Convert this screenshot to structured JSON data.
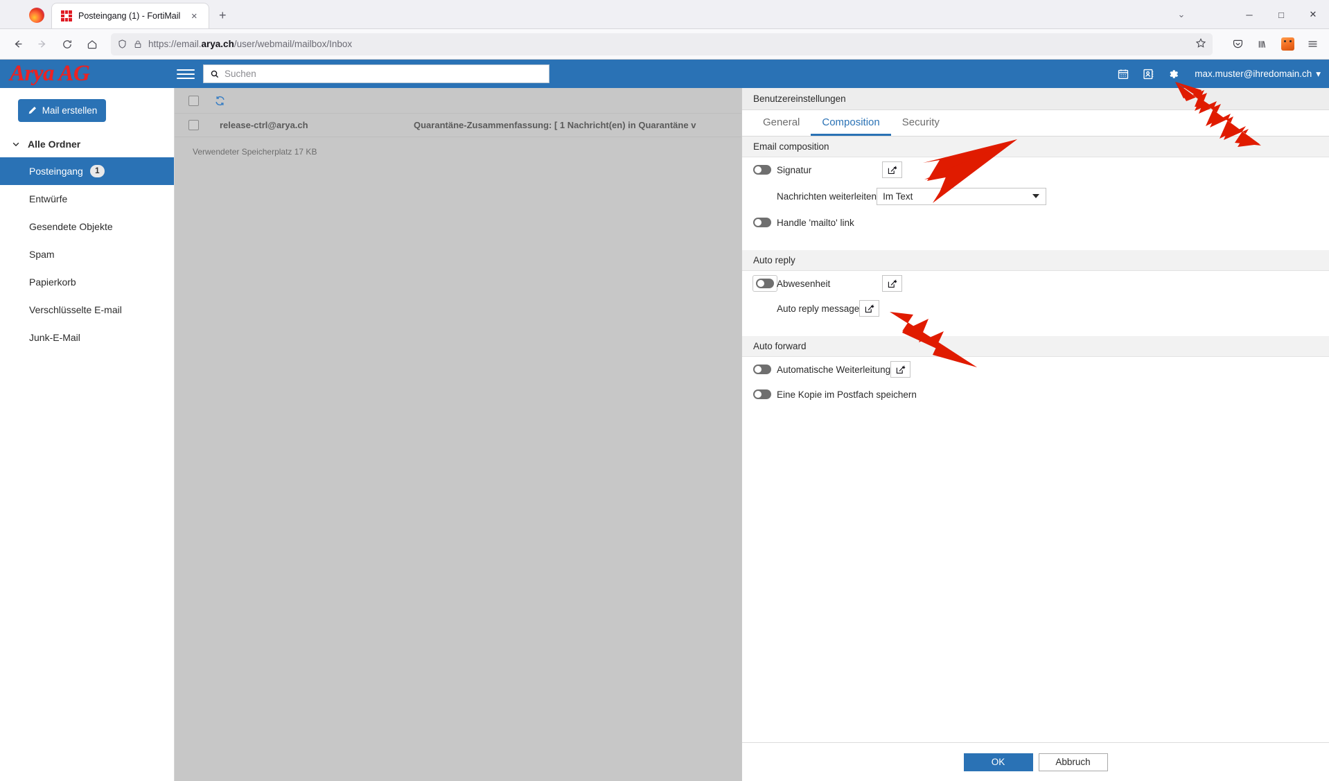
{
  "browser": {
    "tab_title": "Posteingang (1) - FortiMail",
    "tab_close_label": "×",
    "new_tab_label": "+",
    "url_prefix": "https://email.",
    "url_domain": "arya.ch",
    "url_suffix": "/user/webmail/mailbox/Inbox",
    "window_chevron": "⌄",
    "window_minimize": "─",
    "window_maximize": "□",
    "window_close": "✕",
    "icons": {
      "firefox": "firefox-logo-icon",
      "favicon": "fortimail-favicon-icon",
      "back": "back-arrow-icon",
      "forward": "forward-arrow-icon",
      "reload": "reload-icon",
      "home": "home-icon",
      "shield": "shield-icon",
      "lock": "padlock-icon",
      "star": "bookmark-star-icon",
      "pocket": "save-to-pocket-icon",
      "library": "library-icon",
      "extension": "metamask-extension-icon",
      "menu": "hamburger-menu-icon"
    }
  },
  "app_header": {
    "brand": "Arya AG",
    "menu_icon": "hamburger-menu-icon",
    "search_placeholder": "Suchen",
    "search_value": "",
    "calendar_icon": "calendar-icon",
    "contacts_icon": "address-book-icon",
    "settings_icon": "gear-icon",
    "user_email": "max.muster@ihredomain.ch",
    "user_caret": "▾"
  },
  "sidebar": {
    "compose_label": "Mail erstellen",
    "compose_icon": "pencil-icon",
    "all_folders_label": "Alle Ordner",
    "all_folders_caret": "⌄",
    "items": [
      {
        "label": "Posteingang",
        "count": "1",
        "active": true
      },
      {
        "label": "Entwürfe",
        "count": "",
        "active": false
      },
      {
        "label": "Gesendete Objekte",
        "count": "",
        "active": false
      },
      {
        "label": "Spam",
        "count": "",
        "active": false
      },
      {
        "label": "Papierkorb",
        "count": "",
        "active": false
      },
      {
        "label": "Verschlüsselte E-mail",
        "count": "",
        "active": false
      },
      {
        "label": "Junk-E-Mail",
        "count": "",
        "active": false
      }
    ]
  },
  "maillist": {
    "select_all_icon": "checkbox-icon",
    "refresh_icon": "refresh-icon",
    "rows": [
      {
        "from": "release-ctrl@arya.ch",
        "subject": "Quarantäne-Zusammenfassung: [ 1 Nachricht(en) in Quarantäne v"
      }
    ],
    "storage_note": "Verwendeter Speicherplatz 17 KB"
  },
  "settings": {
    "title": "Benutzereinstellungen",
    "tabs": [
      {
        "label": "General",
        "active": false
      },
      {
        "label": "Composition",
        "active": true
      },
      {
        "label": "Security",
        "active": false
      }
    ],
    "sections": [
      {
        "heading": "Email composition",
        "rows": [
          {
            "type": "toggle",
            "label": "Signatur",
            "state": "off",
            "edit": true,
            "focused": false
          },
          {
            "type": "select",
            "label": "Nachrichten weiterleiten",
            "value": "Im Text",
            "caret": "▾"
          },
          {
            "type": "toggle",
            "label": "Handle 'mailto' link",
            "state": "off",
            "edit": false,
            "focused": false
          }
        ]
      },
      {
        "heading": "Auto reply",
        "rows": [
          {
            "type": "toggle",
            "label": "Abwesenheit",
            "state": "off",
            "edit": true,
            "focused": true
          },
          {
            "type": "plain",
            "label": "Auto reply message",
            "edit": true
          }
        ]
      },
      {
        "heading": "Auto forward",
        "rows": [
          {
            "type": "toggle",
            "label": "Automatische Weiterleitung",
            "state": "off",
            "edit": true,
            "focused": false
          },
          {
            "type": "toggle",
            "label": "Eine Kopie im Postfach speichern",
            "state": "off",
            "edit": false,
            "focused": false
          }
        ]
      }
    ],
    "edit_icon": "edit-pencil-square-icon",
    "ok_label": "OK",
    "cancel_label": "Abbruch"
  },
  "annotations": {
    "arrow_color": "#e01b00",
    "arrows": [
      {
        "name": "arrow-to-gear-icon"
      },
      {
        "name": "arrow-to-composition-tab"
      },
      {
        "name": "arrow-to-auto-reply-message-edit"
      }
    ]
  },
  "colors": {
    "brand_red": "#ee2222",
    "header_blue": "#2a72b5",
    "accent_blue": "#2a72b5",
    "list_bg": "#c7c7c7"
  }
}
